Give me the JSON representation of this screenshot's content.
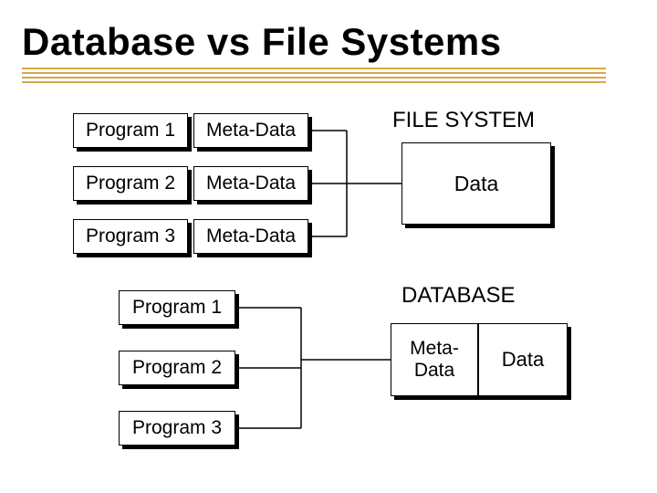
{
  "title": "Database vs File Systems",
  "fs": {
    "heading": "FILE SYSTEM",
    "rows": [
      {
        "program": "Program 1",
        "meta": "Meta-Data"
      },
      {
        "program": "Program 2",
        "meta": "Meta-Data"
      },
      {
        "program": "Program 3",
        "meta": "Meta-Data"
      }
    ],
    "data_box": "Data"
  },
  "db": {
    "heading": "DATABASE",
    "programs": [
      "Program 1",
      "Program 2",
      "Program 3"
    ],
    "meta_box": "Meta-\nData",
    "data_box": "Data"
  }
}
